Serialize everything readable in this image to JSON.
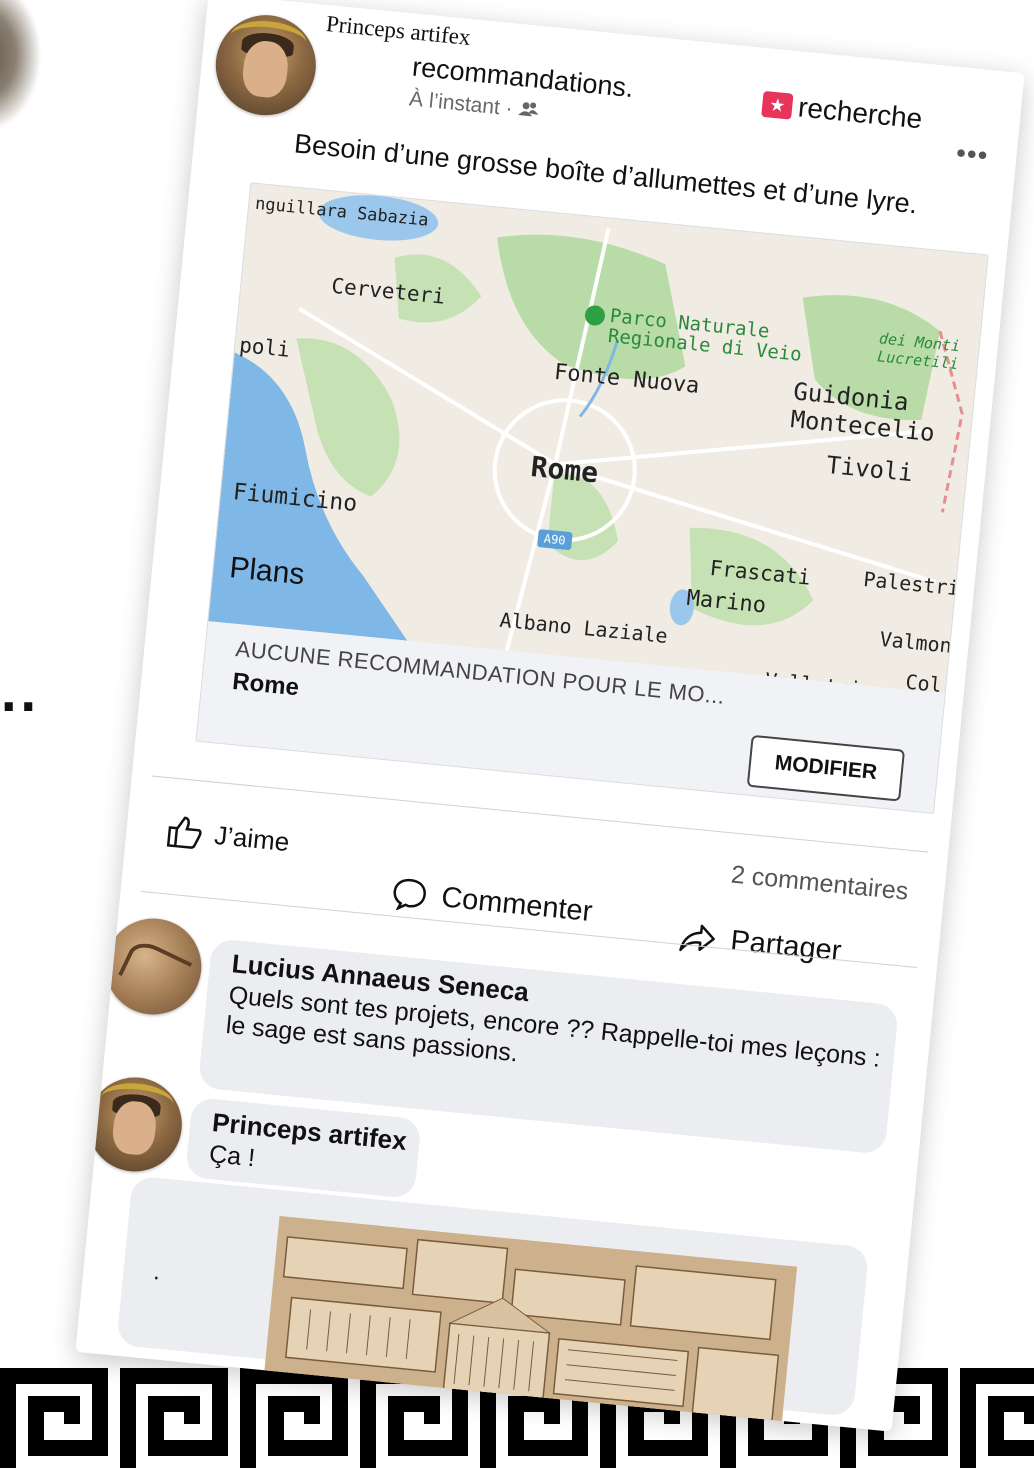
{
  "post": {
    "author": "Princeps artifex",
    "group": "recommandations.",
    "timestamp": "À l’instant · ",
    "tag": "recherche",
    "text": "Besoin d’une grosse boîte d’allumettes et d’une lyre."
  },
  "map": {
    "provider": "Plans",
    "labels": {
      "anguillara": "nguillara Sabazia",
      "parco": "Parco Naturale",
      "parco2": "Regionale di Veio",
      "monti": "dei Monti",
      "lucretili": "Lucretili",
      "cerveteri": "Cerveteri",
      "poli": "poli",
      "fonte_nuova": "Fonte Nuova",
      "guidonia": "Guidonia",
      "montecelio": "Montecelio",
      "tivoli": "Tivoli",
      "rome": "Rome",
      "fiumicino": "Fiumicino",
      "a90": "A90",
      "frascati": "Frascati",
      "palestrina": "Palestrina",
      "marino": "Marino",
      "albano": "Albano Laziale",
      "valmonto": "Valmonto",
      "col": "Col",
      "velletri": "Velletri"
    },
    "colors": {
      "water": "#7fb7e6",
      "park": "#b9dba8",
      "land": "#f0ece4",
      "road": "#ffffff"
    }
  },
  "recommendation": {
    "caption": "AUCUNE RECOMMANDATION POUR LE MO...",
    "city": "Rome",
    "modify_label": "MODIFIER"
  },
  "actions": {
    "like": "J’aime",
    "comment": "Commenter",
    "share": "Partager",
    "comment_count": "2 commentaires"
  },
  "comments": [
    {
      "author": "Lucius Annaeus Seneca",
      "text": "Quels sont tes projets, encore ?? Rappelle-toi mes leçons : le sage est sans passions."
    },
    {
      "author": "Princeps artifex",
      "text": "Ça !"
    }
  ],
  "decor": {
    "ellipsis": "..",
    "comment_dot": "."
  }
}
